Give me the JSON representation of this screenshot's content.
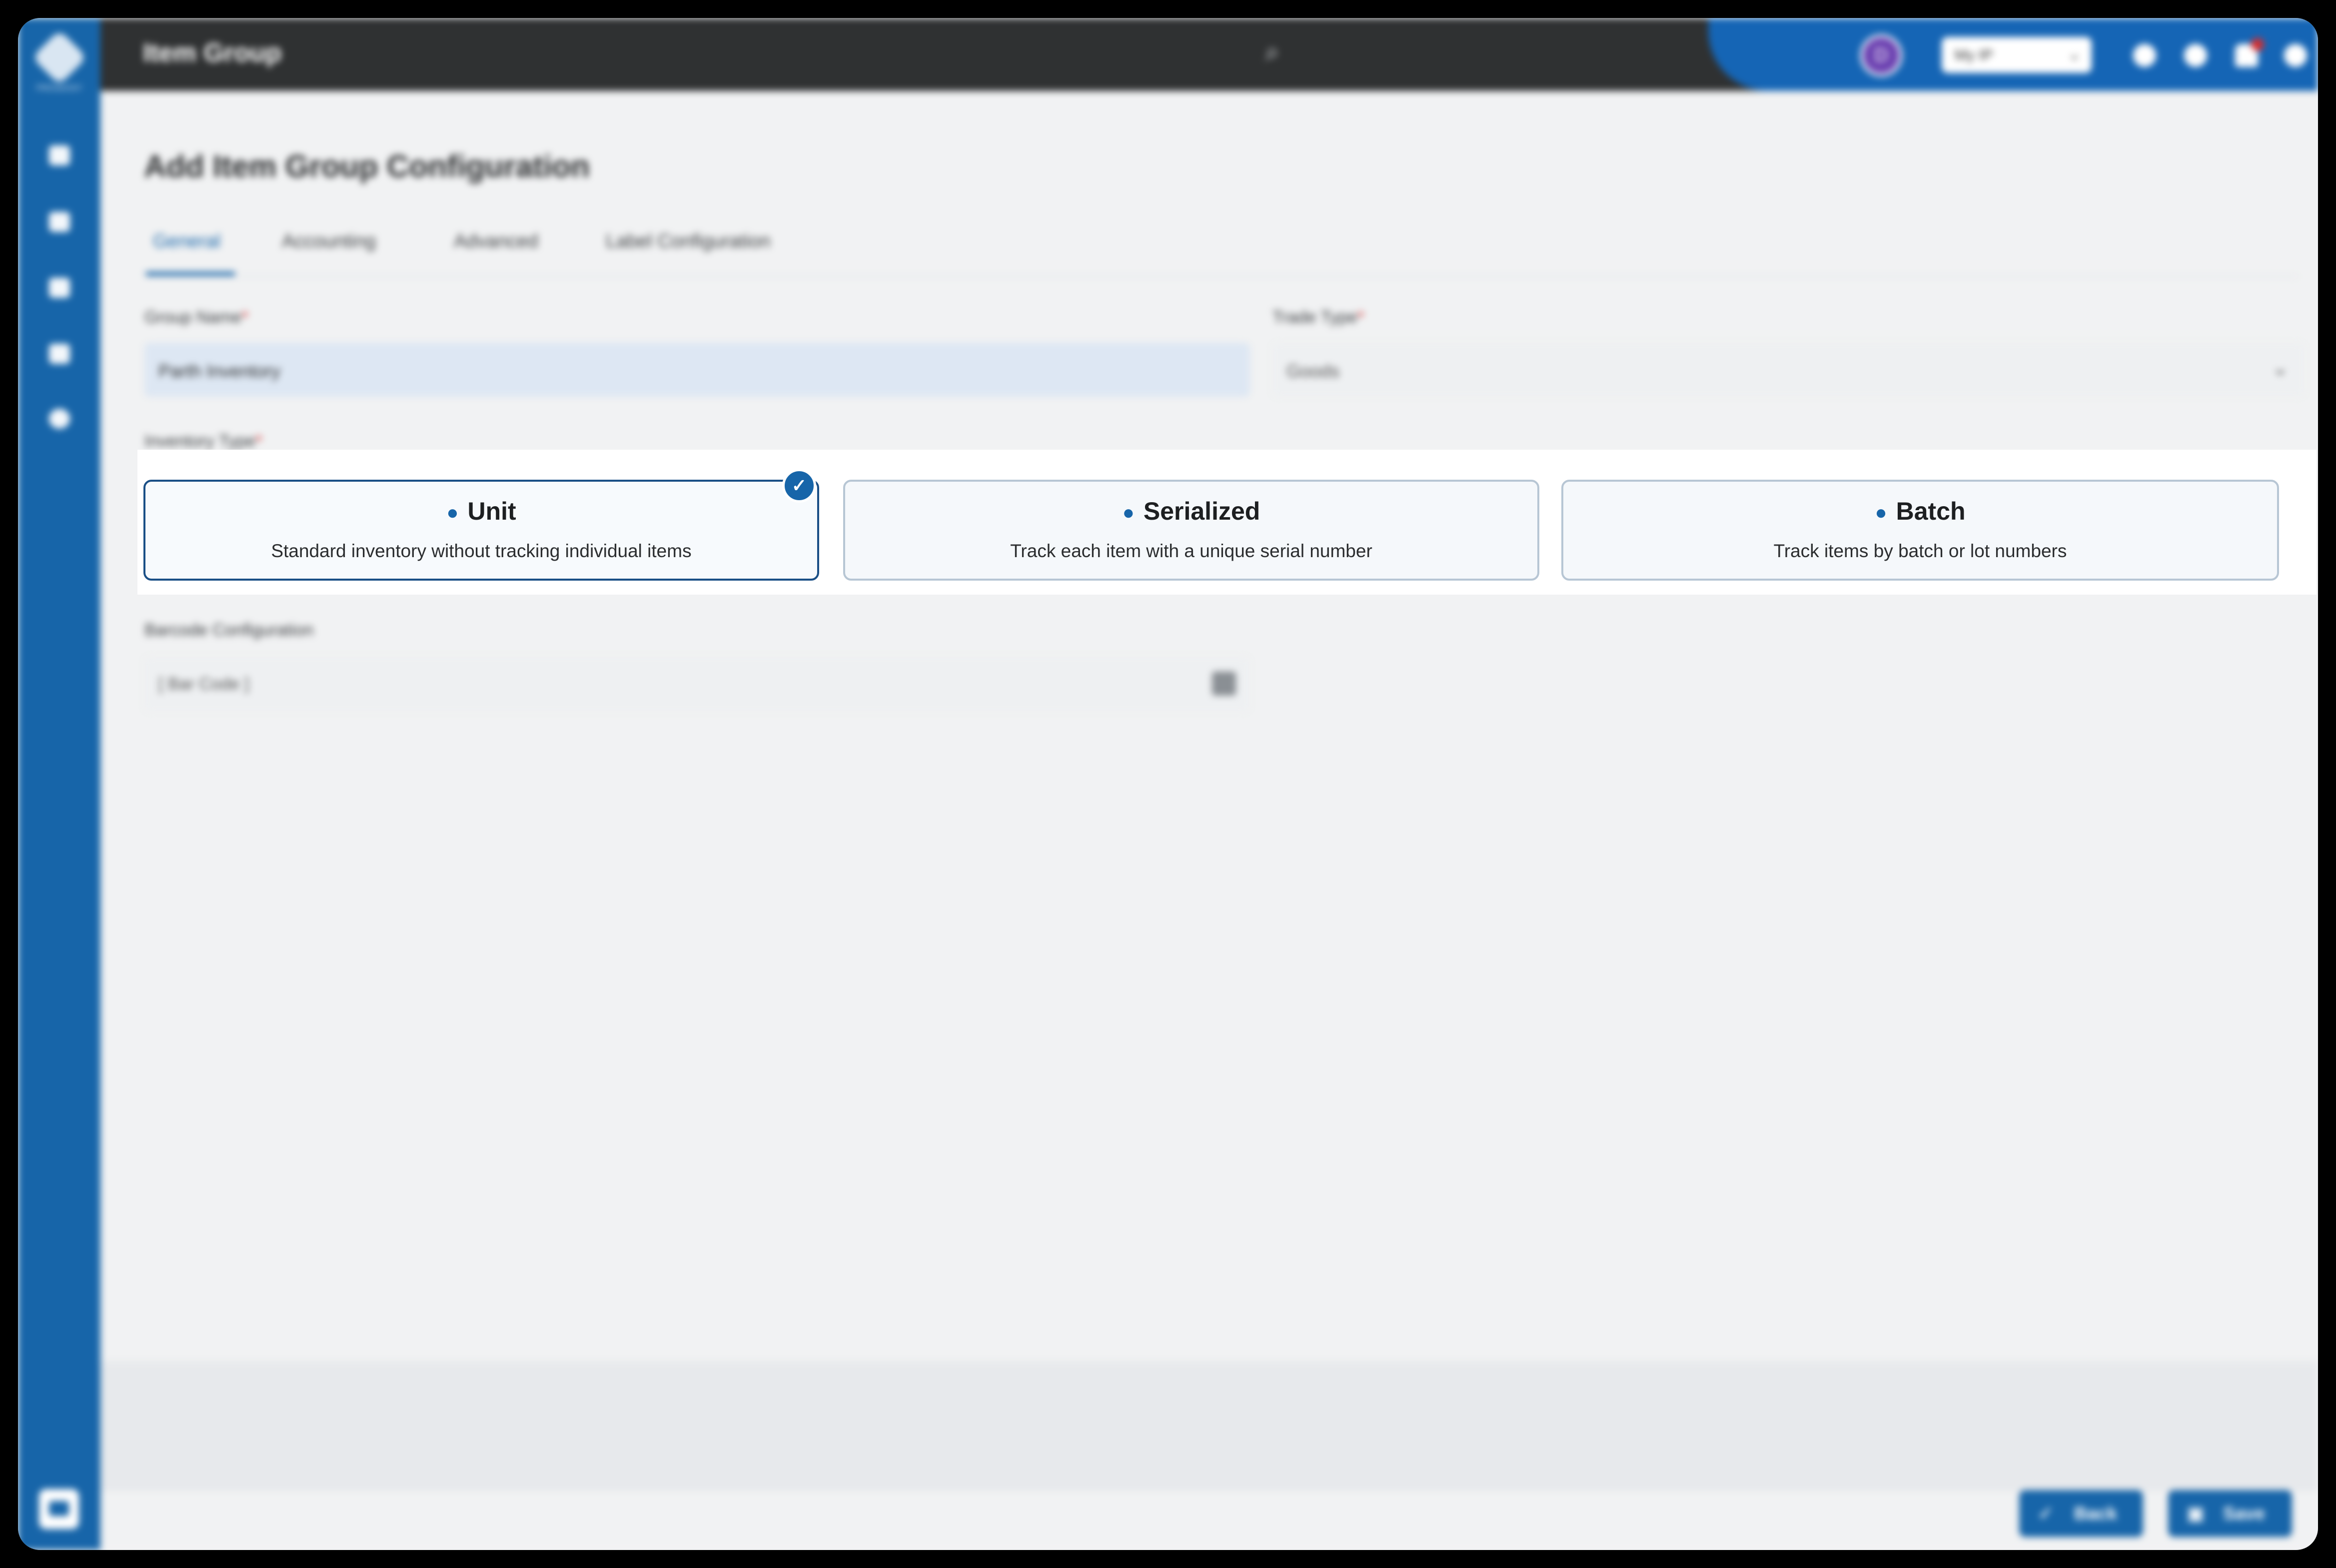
{
  "app": {
    "logo_text": "PRICEEASY",
    "title": "Item Group"
  },
  "header": {
    "avatar_initial": "D",
    "branch_select": "My IP",
    "notification_count": "1"
  },
  "page": {
    "title": "Add Item Group Configuration",
    "tabs": [
      {
        "label": "General"
      },
      {
        "label": "Accounting"
      },
      {
        "label": "Advanced"
      },
      {
        "label": "Label Configuration"
      }
    ]
  },
  "form": {
    "group_name": {
      "label": "Group Name",
      "value": "Parth Inventory"
    },
    "trade_type": {
      "label": "Trade Type",
      "value": "Goods"
    },
    "inventory_type": {
      "label": "Inventory Type",
      "options": [
        {
          "title": "Unit",
          "desc": "Standard inventory without tracking individual items",
          "selected": true
        },
        {
          "title": "Serialized",
          "desc": "Track each item with a unique serial number",
          "selected": false
        },
        {
          "title": "Batch",
          "desc": "Track items by batch or lot numbers",
          "selected": false
        }
      ]
    },
    "barcode": {
      "label": "Barcode Configuration",
      "value": "[ Bar Code ]"
    }
  },
  "actions": {
    "back_label": "Back",
    "save_label": "Save"
  },
  "colors": {
    "primary": "#1765a9",
    "topbar": "#2f3132",
    "selected_border": "#1a4f86"
  }
}
